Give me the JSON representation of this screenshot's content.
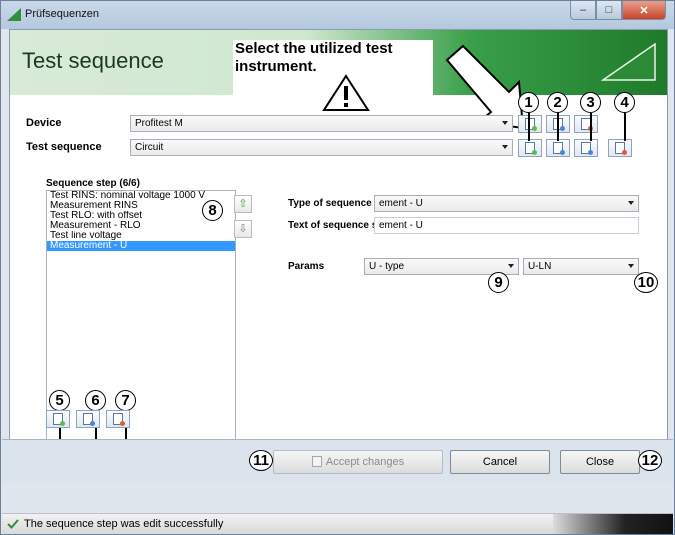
{
  "window": {
    "title": "Prüfsequenzen"
  },
  "banner": {
    "title": "Test sequence",
    "note": "Select the utilized test instrument."
  },
  "form": {
    "device_label": "Device",
    "device_value": "Profitest M",
    "sequence_label": "Test sequence",
    "sequence_value": "Circuit",
    "steps_label": "Sequence step (6/6)",
    "steps": [
      "Test RINS: nominal voltage 1000 V",
      "Measurement RINS",
      "Test RLO: with offset",
      "Measurement - RLO",
      "Test line voltage",
      "Measurement - U"
    ],
    "selected_step_index": 5,
    "type_label": "Type of sequence step",
    "type_value": "ement - U",
    "text_label": "Text of sequence step",
    "text_value": "ement - U",
    "params_label": "Params",
    "param1_value": "U - type",
    "param2_value": "U-LN"
  },
  "callouts": [
    "1",
    "2",
    "3",
    "4",
    "5",
    "6",
    "7",
    "8",
    "9",
    "10",
    "11",
    "12"
  ],
  "buttons": {
    "accept": "Accept changes",
    "cancel": "Cancel",
    "close": "Close"
  },
  "status": {
    "text": "The sequence step was edit successfully"
  },
  "colors": {
    "accent_green": "#3aa04a",
    "selection_blue": "#3399ff"
  }
}
